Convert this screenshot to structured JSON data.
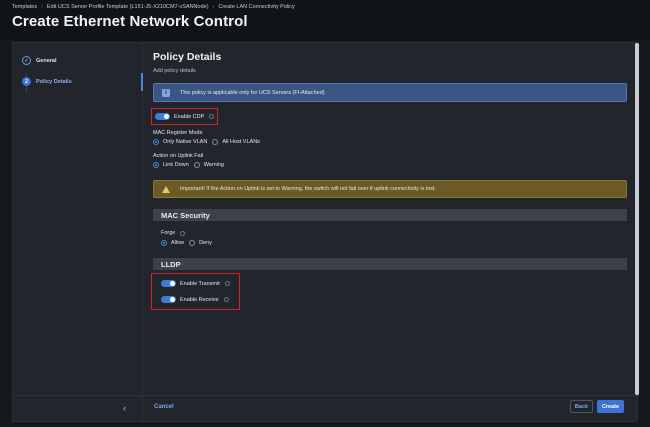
{
  "breadcrumb": {
    "items": [
      "Templates",
      "Edit UCS Server Profile Template (L151-J5-X210CM7-vSANNode)",
      "Create LAN Connectivity Policy"
    ]
  },
  "page": {
    "title": "Create Ethernet Network Control"
  },
  "nav": {
    "items": [
      {
        "label": "General",
        "marker": "✓"
      },
      {
        "label": "Policy Details",
        "marker": "2"
      }
    ],
    "collapse_icon": "chevron-left-icon"
  },
  "policy": {
    "title": "Policy Details",
    "subtitle": "Add policy details",
    "info_banner": "This policy is applicable only for UCS Servers (FI-Attached)",
    "enable_cdp": {
      "label": "Enable CDP",
      "on": true
    },
    "mac_register_mode": {
      "label": "MAC Register Mode",
      "options": [
        "Only Native VLAN",
        "All Host VLANs"
      ],
      "selected": "Only Native VLAN"
    },
    "action_on_uplink_fail": {
      "label": "Action on Uplink Fail",
      "options": [
        "Link Down",
        "Warning"
      ],
      "selected": "Link Down"
    },
    "warning_banner": "Important! If the Action on Uplink is set to Warning, the switch will not fail over if uplink connectivity is lost."
  },
  "mac_security": {
    "title": "MAC Security",
    "forge": {
      "label": "Forge",
      "options": [
        "Allow",
        "Deny"
      ],
      "selected": "Allow"
    }
  },
  "lldp": {
    "title": "LLDP",
    "enable_transmit": {
      "label": "Enable Transmit",
      "on": true
    },
    "enable_receive": {
      "label": "Enable Receive",
      "on": true
    }
  },
  "footer": {
    "cancel": "Cancel",
    "back": "Back",
    "create": "Create"
  },
  "colors": {
    "accent": "#3d73d3",
    "highlight": "#d0262a",
    "info": "#3b5684",
    "warning": "#6a5a25"
  }
}
